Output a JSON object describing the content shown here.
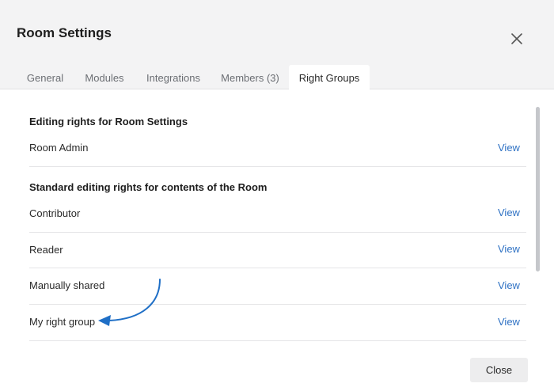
{
  "dialog": {
    "title": "Room Settings",
    "close_icon": "close-x-icon"
  },
  "tabs": [
    {
      "label": "General",
      "active": false
    },
    {
      "label": "Modules",
      "active": false
    },
    {
      "label": "Integrations",
      "active": false
    },
    {
      "label": "Members (3)",
      "active": false
    },
    {
      "label": "Right Groups",
      "active": true
    }
  ],
  "sections": [
    {
      "title": "Editing rights for Room Settings",
      "rows": [
        {
          "label": "Room Admin",
          "action": "View"
        }
      ]
    },
    {
      "title": "Standard editing rights for contents of the Room",
      "rows": [
        {
          "label": "Contributor",
          "action": "View"
        },
        {
          "label": "Reader",
          "action": "View"
        },
        {
          "label": "Manually shared",
          "action": "View"
        },
        {
          "label": "My right group",
          "action": "View"
        }
      ]
    }
  ],
  "footer": {
    "close_label": "Close"
  },
  "annotation": {
    "icon": "curved-arrow-icon",
    "color": "#1f6fc6"
  },
  "colors": {
    "header_bg": "#f3f3f4",
    "link": "#2f72c4",
    "scrollbar": "#c5c7cb"
  }
}
